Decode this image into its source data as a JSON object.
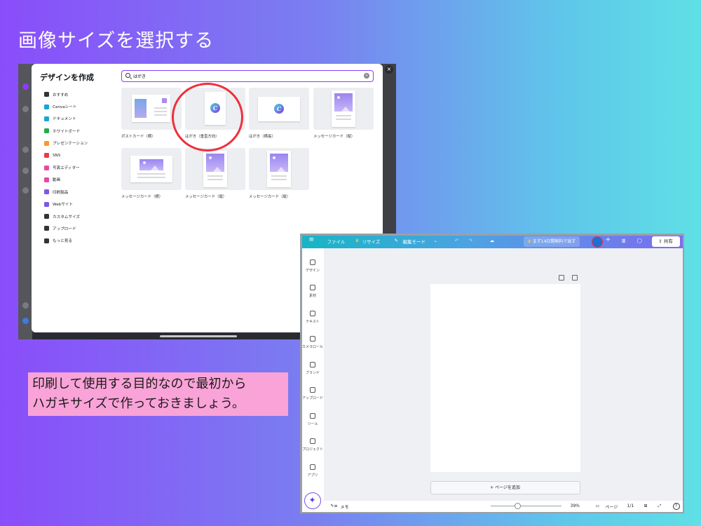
{
  "slide": {
    "title": "画像サイズを選択する",
    "caption_line1": "印刷して使用する目的なので最初から",
    "caption_line2": "ハガキサイズで作っておきましょう。"
  },
  "design_dialog": {
    "title": "デザインを作成",
    "search_value": "はがき",
    "close_glyph": "×",
    "menu": [
      {
        "label": "おすすめ",
        "icon": "sparkle-icon",
        "color": "#333333"
      },
      {
        "label": "Canvaシート",
        "icon": "sheet-icon",
        "color": "#1aa3d9"
      },
      {
        "label": "ドキュメント",
        "icon": "doc-icon",
        "color": "#1aa3d9"
      },
      {
        "label": "ホワイトボード",
        "icon": "whiteboard-icon",
        "color": "#2aa84a"
      },
      {
        "label": "プレゼンテーション",
        "icon": "presentation-icon",
        "color": "#f59b2b"
      },
      {
        "label": "SNS",
        "icon": "heart-icon",
        "color": "#e63b4a"
      },
      {
        "label": "写真エディター",
        "icon": "camera-icon",
        "color": "#e64aa0"
      },
      {
        "label": "動画",
        "icon": "video-icon",
        "color": "#e64aa0"
      },
      {
        "label": "印刷製品",
        "icon": "printer-icon",
        "color": "#7b58e8"
      },
      {
        "label": "Webサイト",
        "icon": "web-icon",
        "color": "#7b58e8"
      },
      {
        "label": "カスタムサイズ",
        "icon": "custom-size-icon",
        "color": "#333333"
      },
      {
        "label": "アップロード",
        "icon": "upload-cloud-icon",
        "color": "#333333"
      },
      {
        "label": "もっと見る",
        "icon": "more-icon",
        "color": "#333333"
      }
    ],
    "templates": [
      {
        "label": "ポストカード（横）"
      },
      {
        "label": "はがき（垂直方向）"
      },
      {
        "label": "はがき（横長）"
      },
      {
        "label": "メッセージカード（縦）"
      },
      {
        "label": "メッセージカード（横）"
      },
      {
        "label": "メッセージカード（縦）"
      },
      {
        "label": "メッセージカード（縦）"
      }
    ]
  },
  "editor": {
    "topbar": {
      "menu_glyph": "≡",
      "file": "ファイル",
      "resize": "リサイズ",
      "edit_mode": "編集モード",
      "trial": "まず14日間無料で試す",
      "plus": "+",
      "share": "共有"
    },
    "rail": [
      {
        "label": "デザイン",
        "icon": "design-icon"
      },
      {
        "label": "素材",
        "icon": "elements-icon"
      },
      {
        "label": "テキスト",
        "icon": "text-icon"
      },
      {
        "label": "カメラロール",
        "icon": "camera-icon"
      },
      {
        "label": "ブランド",
        "icon": "brand-icon"
      },
      {
        "label": "アップロード",
        "icon": "upload-icon"
      },
      {
        "label": "ツール",
        "icon": "pen-icon"
      },
      {
        "label": "プロジェクト",
        "icon": "folder-icon"
      },
      {
        "label": "アプリ",
        "icon": "apps-icon"
      }
    ],
    "add_page": "+ ページを追加",
    "bottom": {
      "notes": "メモ",
      "zoom": "39%",
      "pages": "ページ",
      "page_count": "1/1",
      "help": "?"
    },
    "zoom_fraction": 0.39
  }
}
